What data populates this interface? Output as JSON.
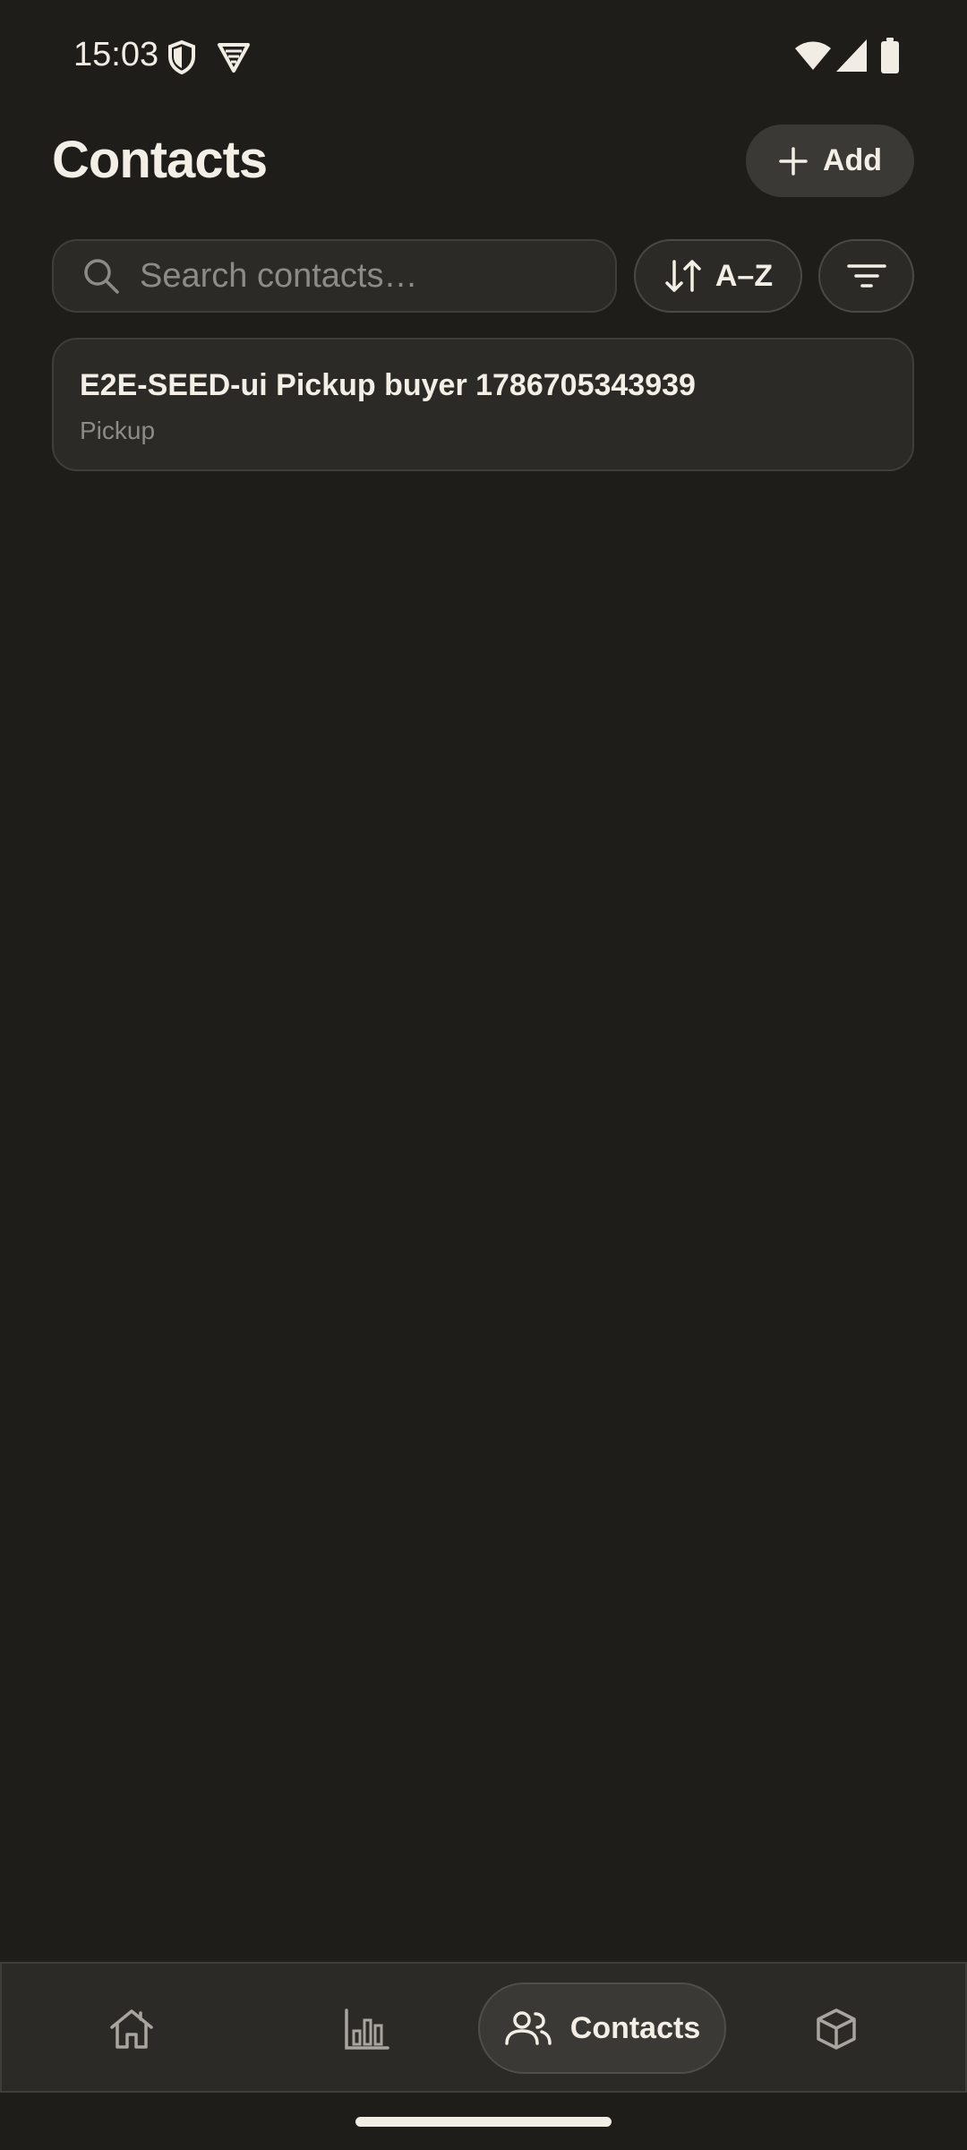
{
  "status_bar": {
    "time": "15:03",
    "icons": [
      "shield-icon",
      "vpn-icon",
      "wifi-icon",
      "signal-icon",
      "battery-icon"
    ]
  },
  "header": {
    "title": "Contacts",
    "add_label": "Add"
  },
  "search": {
    "placeholder": "Search contacts…",
    "value": ""
  },
  "sort": {
    "label": "A–Z"
  },
  "contacts": [
    {
      "name": "E2E-SEED-ui Pickup buyer 1786705343939",
      "type": "Pickup"
    }
  ],
  "bottom_nav": {
    "items": [
      {
        "id": "home",
        "icon": "home-icon",
        "label": ""
      },
      {
        "id": "stats",
        "icon": "bar-chart-icon",
        "label": ""
      },
      {
        "id": "contacts",
        "icon": "people-icon",
        "label": "Contacts",
        "active": true
      },
      {
        "id": "inventory",
        "icon": "box-icon",
        "label": ""
      }
    ]
  },
  "colors": {
    "background": "#1e1d1a",
    "surface": "#2b2a27",
    "surface_raised": "#3a3935",
    "text_primary": "#f3efe6",
    "text_secondary": "#8d8b86"
  }
}
